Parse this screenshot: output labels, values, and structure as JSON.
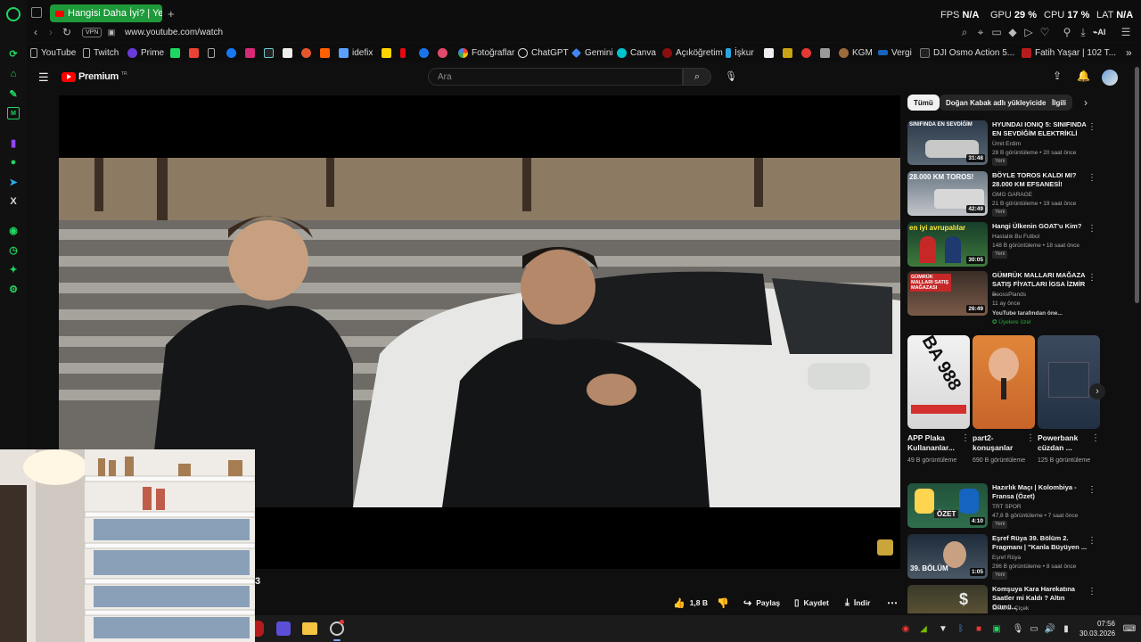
{
  "colors": {
    "opera_accent": "#1ed760",
    "yt_red": "#ff0000",
    "tab_active": "#1e9a3a"
  },
  "browser": {
    "tab_title": "Hangisi Daha İyi? | Yeni Te",
    "new_tab": "+",
    "perf": {
      "fps_label": "FPS",
      "fps_value": "N/A",
      "gpu_label": "GPU",
      "gpu_value": "29 %",
      "cpu_label": "CPU",
      "cpu_value": "17 %",
      "lat_label": "LAT",
      "lat_value": "N/A"
    },
    "vpn_label": "VPN",
    "url": "www.youtube.com/watch",
    "ai_label": "AI"
  },
  "bookmarks": [
    {
      "label": "YouTube",
      "icon": "page-icon"
    },
    {
      "label": "Twitch",
      "icon": "page-icon"
    },
    {
      "label": "Prime",
      "icon": "prime-icon"
    },
    {
      "label": "idefix",
      "icon": "idefix-icon"
    },
    {
      "label": "Fotoğraflar",
      "icon": "photos-icon"
    },
    {
      "label": "ChatGPT",
      "icon": "chatgpt-icon"
    },
    {
      "label": "Gemini",
      "icon": "gemini-icon"
    },
    {
      "label": "Canva",
      "icon": "canva-icon"
    },
    {
      "label": "Açıköğretim",
      "icon": "aof-icon"
    },
    {
      "label": "İşkur",
      "icon": "iskur-icon"
    },
    {
      "label": "KGM",
      "icon": "kgm-icon"
    },
    {
      "label": "Vergi",
      "icon": "vergi-icon"
    },
    {
      "label": "DJI Osmo Action 5...",
      "icon": "dji-icon"
    },
    {
      "label": "Fatih Yaşar | 102 T...",
      "icon": "fy-icon"
    }
  ],
  "youtube": {
    "logo_text": "Premium",
    "logo_region": "TR",
    "search_placeholder": "Ara",
    "chips": [
      "Tümü",
      "Doğan Kabak adlı yükleyiciden",
      "İlgili"
    ],
    "video_title_fragment": "/3",
    "actions": {
      "like_count": "1,8 B",
      "share": "Paylaş",
      "save": "Kaydet",
      "download": "İndir"
    },
    "recommendations": [
      {
        "title": "HYUNDAI IONIQ 5: SINIFINDA EN SEVDİĞİM ELEKTRİKLİ",
        "channel": "Ümit Erdim",
        "meta": "28 B görüntüleme • 20 saat önce",
        "badge": "Yeni",
        "duration": "31:48",
        "thumb_text": "SINIFINDA EN SEVDİĞİM"
      },
      {
        "title": "BÖYLE TOROS KALDI MI? 28.000 KM EFSANESİ!",
        "channel": "GMG GARAGE",
        "meta": "21 B görüntüleme • 19 saat önce",
        "badge": "Yeni",
        "duration": "42:49",
        "thumb_text": "28.000 KM TOROS!"
      },
      {
        "title": "Hangi Ülkenin GOAT'u Kim?",
        "channel": "Hastalık Bu Futbol",
        "meta": "148 B görüntüleme • 18 saat önce",
        "badge": "Yeni",
        "duration": "30:05",
        "thumb_text": "en iyi avrupalılar"
      },
      {
        "title": "GÜMRÜK MALLARI MAĞAZA SATIŞ FİYATLARI İGSA İZMİR ...",
        "channel": "BoossPlands",
        "meta": "11 ay önce",
        "badge": "YouTube tarafından öne...",
        "badge2": "Üyelere özel",
        "duration": "26:49",
        "thumb_text": "GÜMRÜK MALLARI SATIŞ MAĞAZASI"
      },
      {
        "title": "Hazırlık Maçı | Kolombiya - Fransa (Özet)",
        "channel": "TRT SPOR",
        "meta": "47,8 B görüntüleme • 7 saat önce",
        "badge": "Yeni",
        "duration": "4:10",
        "thumb_text": "ÖZET"
      },
      {
        "title": "Eşref Rüya 39. Bölüm 2. Fragmanı | \"Kanla Büyüyen ...",
        "channel": "Eşref Rüya",
        "meta": "296 B görüntüleme • 8 saat önce",
        "badge": "Yeni",
        "duration": "1:05",
        "thumb_text": "39. BÖLÜM"
      },
      {
        "title": "Komşuya Kara Harekatına Saatler mi Kaldı ? Altın Gümü...",
        "channel": "Cihat E. Çiçek",
        "meta": "",
        "badge": "",
        "duration": "",
        "thumb_text": ""
      }
    ],
    "shorts": [
      {
        "title": "APP Plaka Kullananlar...",
        "views": "49 B görüntüleme",
        "thumb_text": "BA 988"
      },
      {
        "title": "part2-konuşanlar",
        "views": "690 B görüntüleme",
        "thumb_text": ""
      },
      {
        "title": "Powerbank cüzdan ...",
        "views": "125 B görüntüleme",
        "thumb_text": ""
      }
    ]
  },
  "taskbar": {
    "time": "07:56",
    "date": "30.03.2026"
  }
}
